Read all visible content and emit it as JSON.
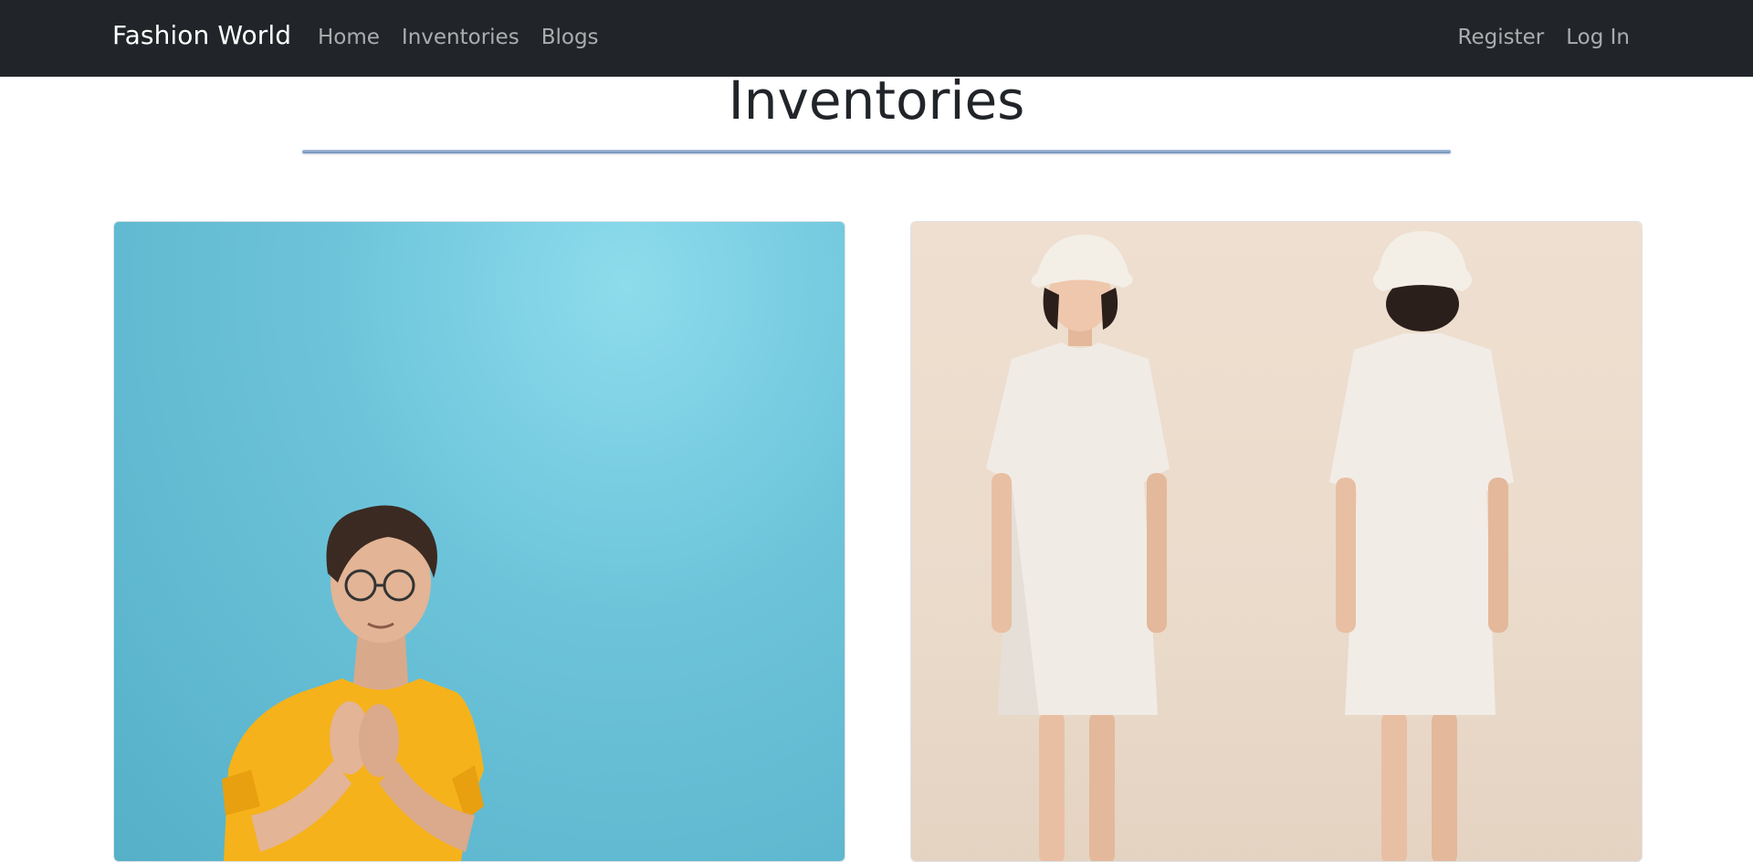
{
  "navbar": {
    "brand": "Fashion World",
    "left_links": [
      "Home",
      "Inventories",
      "Blogs"
    ],
    "right_links": [
      "Register",
      "Log In"
    ]
  },
  "page": {
    "title": "Inventories"
  },
  "inventory_cards": [
    {
      "image": "man-in-yellow-tshirt-photo"
    },
    {
      "image": "woman-in-white-tshirt-dress-photo"
    }
  ],
  "colors": {
    "navbar_bg": "#212529",
    "title_rule": "#6e8eb8"
  }
}
